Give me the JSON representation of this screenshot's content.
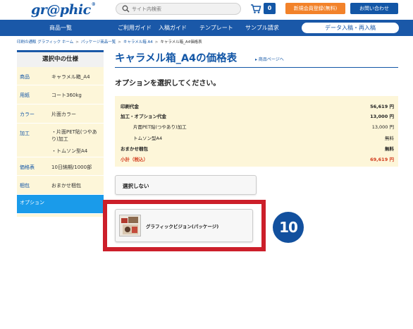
{
  "header": {
    "logo": "gr@phic",
    "logo_mark": "®",
    "search_placeholder": "サイト内検索",
    "cart_count": "0",
    "register_button": "新規会員登録(無料)",
    "contact_button": "お問い合わせ"
  },
  "nav": {
    "items": [
      "商品一覧",
      "ご利用ガイド",
      "入稿ガイド",
      "テンプレート",
      "サンプル請求"
    ],
    "pill": "データ入稿・再入稿"
  },
  "breadcrumb": {
    "items": [
      "印刷の通販 グラフィック ホーム",
      "パッケージ商品一覧",
      "キャラメル箱 A4"
    ],
    "current": "キャラメル箱_A4価格表"
  },
  "sidebar": {
    "heading": "選択中の仕様",
    "rows": [
      {
        "key": "商品",
        "value": "キャラメル箱_A4"
      },
      {
        "key": "用紙",
        "value": "コート360kg"
      },
      {
        "key": "カラー",
        "value": "片面カラー"
      },
      {
        "key": "加工",
        "value": "・片面PET貼(つやあり)加工",
        "value2": "・トムソン型A4"
      },
      {
        "key": "価格表",
        "value": "10日納期/1000部"
      },
      {
        "key": "梱包",
        "value": "おまかせ梱包"
      },
      {
        "key": "オプション",
        "value": ""
      }
    ]
  },
  "main": {
    "title": "キャラメル箱_A4の価格表",
    "title_link": "▸ 商品ページへ",
    "subtitle": "オプションを選択してください。",
    "price_rows": [
      {
        "label": "印刷代金",
        "value": "56,619 円"
      },
      {
        "label": "加工・オプション代金",
        "value": "13,000 円"
      },
      {
        "label": "片面PET貼(つやあり)加工",
        "value": "13,000 円"
      },
      {
        "label": "トムソン型A4",
        "value": "無料"
      },
      {
        "label": "おまかせ梱包",
        "value": "無料"
      },
      {
        "label": "小計（税込）",
        "value": "69,619 円"
      }
    ],
    "option_none": "選択しない",
    "option_graphic": "グラフィックビジョン(パッケージ)",
    "step_badge": "10"
  },
  "colors": {
    "brand_blue": "#1a58a8",
    "accent_orange": "#f2822a",
    "highlight_red": "#cc1f2a",
    "active_blue": "#1a9bea",
    "panel_cream": "#fdf6d9"
  }
}
